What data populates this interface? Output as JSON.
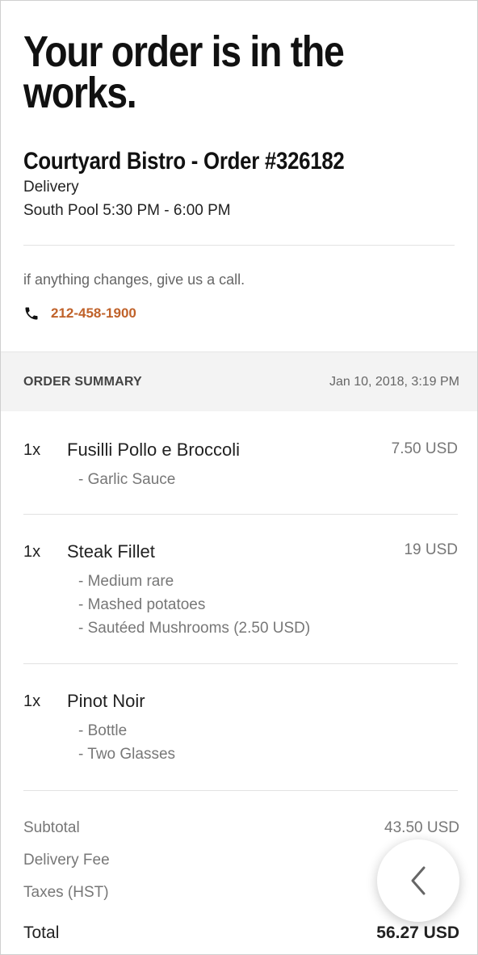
{
  "header": {
    "headline": "Your order is in the works.",
    "restaurant_order": "Courtyard Bistro - Order #326182",
    "service_type": "Delivery",
    "delivery_window": "South Pool 5:30 PM - 6:00 PM"
  },
  "contact": {
    "message": "if anything changes, give us a call.",
    "phone": "212-458-1900",
    "icon": "phone-icon",
    "accent_color": "#c0622a"
  },
  "summary": {
    "title": "ORDER SUMMARY",
    "date": "Jan 10, 2018, 3:19 PM"
  },
  "items": [
    {
      "qty": "1x",
      "name": "Fusilli Pollo e Broccoli",
      "price": "7.50 USD",
      "mods": [
        "- Garlic Sauce"
      ]
    },
    {
      "qty": "1x",
      "name": "Steak Fillet",
      "price": "19 USD",
      "mods": [
        "- Medium rare",
        "- Mashed potatoes",
        "- Sautéed Mushrooms (2.50 USD)"
      ]
    },
    {
      "qty": "1x",
      "name": "Pinot Noir",
      "price": "",
      "mods": [
        "- Bottle",
        "- Two Glasses"
      ]
    }
  ],
  "totals": {
    "subtotal_label": "Subtotal",
    "subtotal_value": "43.50 USD",
    "delivery_label": "Delivery Fee",
    "taxes_label": "Taxes (HST)",
    "total_label": "Total",
    "total_value": "56.27 USD"
  },
  "fab": {
    "icon": "chevron-left-icon"
  }
}
